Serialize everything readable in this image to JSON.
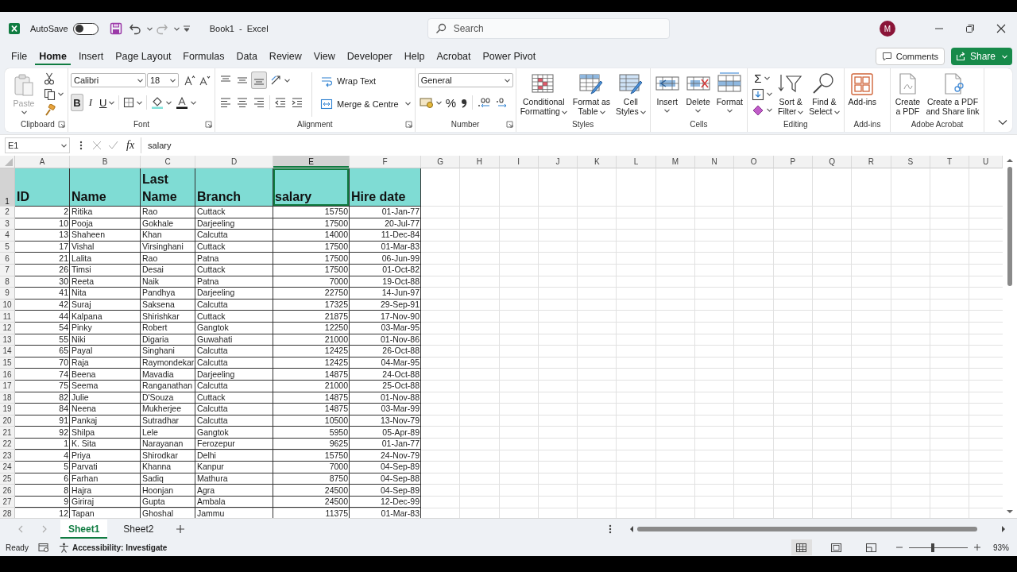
{
  "title_bar": {
    "autosave_label": "AutoSave",
    "autosave_on": false,
    "document_title": "Book1  -  Excel",
    "search_placeholder": "Search",
    "account_initial": "M"
  },
  "menu_tabs": [
    {
      "label": "File",
      "selected": false
    },
    {
      "label": "Home",
      "selected": true
    },
    {
      "label": "Insert",
      "selected": false
    },
    {
      "label": "Page Layout",
      "selected": false
    },
    {
      "label": "Formulas",
      "selected": false
    },
    {
      "label": "Data",
      "selected": false
    },
    {
      "label": "Review",
      "selected": false
    },
    {
      "label": "View",
      "selected": false
    },
    {
      "label": "Developer",
      "selected": false
    },
    {
      "label": "Help",
      "selected": false
    },
    {
      "label": "Acrobat",
      "selected": false
    },
    {
      "label": "Power Pivot",
      "selected": false
    }
  ],
  "comments_button": "Comments",
  "share_button": "Share",
  "ribbon": [
    {
      "kind": "clipboard",
      "label": "Clipboard",
      "launcher": true,
      "paste_label": "Paste",
      "paste_disabled": true
    },
    {
      "kind": "font",
      "label": "Font",
      "launcher": true,
      "font_name": "Calibri",
      "font_size": "18",
      "bold_label": "B",
      "italic_label": "I",
      "underline_label": "U",
      "bold": true
    },
    {
      "kind": "alignment",
      "label": "Alignment",
      "launcher": true,
      "vertical_align": [
        {
          "selected": false
        },
        {
          "selected": false
        },
        {
          "selected": true
        }
      ],
      "wrap_label": "Wrap Text",
      "merge_label": "Merge & Centre"
    },
    {
      "kind": "number",
      "label": "Number",
      "launcher": true,
      "format": "General",
      "percent_label": "%"
    },
    {
      "kind": "large",
      "label": "Styles",
      "launcher": false,
      "buttons": [
        {
          "lines": [
            "Conditional",
            "Formatting"
          ],
          "caret": true
        },
        {
          "lines": [
            "Format as",
            "Table"
          ],
          "caret": true
        },
        {
          "lines": [
            "Cell",
            "Styles"
          ],
          "caret": true
        }
      ]
    },
    {
      "kind": "large",
      "label": "Cells",
      "launcher": false,
      "buttons": [
        {
          "lines": [
            "Insert"
          ],
          "caret": true
        },
        {
          "lines": [
            "Delete"
          ],
          "caret": true
        },
        {
          "lines": [
            "Format"
          ],
          "caret": true
        }
      ]
    },
    {
      "kind": "editing",
      "label": "Editing",
      "launcher": false,
      "sum_label": "Σ",
      "buttons": [
        {
          "lines": [
            "Sort &",
            "Filter"
          ],
          "caret": true
        },
        {
          "lines": [
            "Find &",
            "Select"
          ],
          "caret": true
        }
      ]
    },
    {
      "kind": "large",
      "label": "Add-ins",
      "launcher": false,
      "buttons": [
        {
          "lines": [
            "Add-ins"
          ],
          "caret": false
        }
      ]
    },
    {
      "kind": "large",
      "label": "Adobe Acrobat",
      "launcher": false,
      "buttons": [
        {
          "lines": [
            "Create",
            "a PDF"
          ],
          "caret": false
        },
        {
          "lines": [
            "Create a PDF",
            "and Share link"
          ],
          "caret": false
        }
      ]
    }
  ],
  "formula_bar": {
    "name_box": "E1",
    "function_label": "fx",
    "formula": "salary"
  },
  "columns": [
    {
      "label": "A",
      "selected": false,
      "kind": "number"
    },
    {
      "label": "B",
      "selected": false,
      "kind": "text"
    },
    {
      "label": "C",
      "selected": false,
      "kind": "text"
    },
    {
      "label": "D",
      "selected": false,
      "kind": "text"
    },
    {
      "label": "E",
      "selected": true,
      "kind": "number"
    },
    {
      "label": "F",
      "selected": false,
      "kind": "number"
    },
    {
      "label": "G",
      "selected": false
    },
    {
      "label": "H",
      "selected": false
    },
    {
      "label": "I",
      "selected": false
    },
    {
      "label": "J",
      "selected": false
    },
    {
      "label": "K",
      "selected": false
    },
    {
      "label": "L",
      "selected": false
    },
    {
      "label": "M",
      "selected": false
    },
    {
      "label": "N",
      "selected": false
    },
    {
      "label": "O",
      "selected": false
    },
    {
      "label": "P",
      "selected": false
    },
    {
      "label": "Q",
      "selected": false
    },
    {
      "label": "R",
      "selected": false
    },
    {
      "label": "S",
      "selected": false
    },
    {
      "label": "T",
      "selected": false
    },
    {
      "label": "U",
      "selected": false
    }
  ],
  "rows": [
    {
      "number": "1",
      "selected": true,
      "kind": "header",
      "cells": [
        "ID",
        "Name",
        "Last Name",
        "Branch",
        "salary",
        "Hire date"
      ]
    },
    {
      "number": "2",
      "selected": false,
      "kind": "data",
      "cells": [
        "2",
        "Ritika",
        "Rao",
        "Cuttack",
        "15750",
        "01-Jan-77"
      ]
    },
    {
      "number": "3",
      "selected": false,
      "kind": "data",
      "cells": [
        "10",
        "Pooja",
        "Gokhale",
        "Darjeeling",
        "17500",
        "20-Jul-77"
      ]
    },
    {
      "number": "4",
      "selected": false,
      "kind": "data",
      "cells": [
        "13",
        "Shaheen",
        "Khan",
        "Calcutta",
        "14000",
        "11-Dec-84"
      ]
    },
    {
      "number": "5",
      "selected": false,
      "kind": "data",
      "cells": [
        "17",
        "Vishal",
        "Virsinghani",
        "Cuttack",
        "17500",
        "01-Mar-83"
      ]
    },
    {
      "number": "6",
      "selected": false,
      "kind": "data",
      "cells": [
        "21",
        "Lalita",
        "Rao",
        "Patna",
        "17500",
        "06-Jun-99"
      ]
    },
    {
      "number": "7",
      "selected": false,
      "kind": "data",
      "cells": [
        "26",
        "Timsi",
        "Desai",
        "Cuttack",
        "17500",
        "01-Oct-82"
      ]
    },
    {
      "number": "8",
      "selected": false,
      "kind": "data",
      "cells": [
        "30",
        "Reeta",
        "Naik",
        "Patna",
        "7000",
        "19-Oct-88"
      ]
    },
    {
      "number": "9",
      "selected": false,
      "kind": "data",
      "cells": [
        "41",
        "Nita",
        "Pandhya",
        "Darjeeling",
        "22750",
        "14-Jun-97"
      ]
    },
    {
      "number": "10",
      "selected": false,
      "kind": "data",
      "cells": [
        "42",
        "Suraj",
        "Saksena",
        "Calcutta",
        "17325",
        "29-Sep-91"
      ]
    },
    {
      "number": "11",
      "selected": false,
      "kind": "data",
      "cells": [
        "44",
        "Kalpana",
        "Shirishkar",
        "Cuttack",
        "21875",
        "17-Nov-90"
      ]
    },
    {
      "number": "12",
      "selected": false,
      "kind": "data",
      "cells": [
        "54",
        "Pinky",
        "Robert",
        "Gangtok",
        "12250",
        "03-Mar-95"
      ]
    },
    {
      "number": "13",
      "selected": false,
      "kind": "data",
      "cells": [
        "55",
        "Niki",
        "Digaria",
        "Guwahati",
        "21000",
        "01-Nov-86"
      ]
    },
    {
      "number": "14",
      "selected": false,
      "kind": "data",
      "cells": [
        "65",
        "Payal",
        "Singhani",
        "Calcutta",
        "12425",
        "26-Oct-88"
      ]
    },
    {
      "number": "15",
      "selected": false,
      "kind": "data",
      "cells": [
        "70",
        "Raja",
        "Raymondekar",
        "Calcutta",
        "12425",
        "04-Mar-95"
      ]
    },
    {
      "number": "16",
      "selected": false,
      "kind": "data",
      "cells": [
        "74",
        "Beena",
        "Mavadia",
        "Darjeeling",
        "14875",
        "24-Oct-88"
      ]
    },
    {
      "number": "17",
      "selected": false,
      "kind": "data",
      "cells": [
        "75",
        "Seema",
        "Ranganathan",
        "Calcutta",
        "21000",
        "25-Oct-88"
      ]
    },
    {
      "number": "18",
      "selected": false,
      "kind": "data",
      "cells": [
        "82",
        "Julie",
        "D'Souza",
        "Cuttack",
        "14875",
        "01-Nov-88"
      ]
    },
    {
      "number": "19",
      "selected": false,
      "kind": "data",
      "cells": [
        "84",
        "Neena",
        "Mukherjee",
        "Calcutta",
        "14875",
        "03-Mar-99"
      ]
    },
    {
      "number": "20",
      "selected": false,
      "kind": "data",
      "cells": [
        "91",
        "Pankaj",
        "Sutradhar",
        "Calcutta",
        "10500",
        "13-Nov-79"
      ]
    },
    {
      "number": "21",
      "selected": false,
      "kind": "data",
      "cells": [
        "92",
        "Shilpa",
        "Lele",
        "Gangtok",
        "5950",
        "05-Apr-89"
      ]
    },
    {
      "number": "22",
      "selected": false,
      "kind": "data",
      "cells": [
        "1",
        "K. Sita",
        "Narayanan",
        "Ferozepur",
        "9625",
        "01-Jan-77"
      ]
    },
    {
      "number": "23",
      "selected": false,
      "kind": "data",
      "cells": [
        "4",
        "Priya",
        "Shirodkar",
        "Delhi",
        "15750",
        "24-Nov-79"
      ]
    },
    {
      "number": "24",
      "selected": false,
      "kind": "data",
      "cells": [
        "5",
        "Parvati",
        "Khanna",
        "Kanpur",
        "7000",
        "04-Sep-89"
      ]
    },
    {
      "number": "25",
      "selected": false,
      "kind": "data",
      "cells": [
        "6",
        "Farhan",
        "Sadiq",
        "Mathura",
        "8750",
        "04-Sep-88"
      ]
    },
    {
      "number": "26",
      "selected": false,
      "kind": "data",
      "cells": [
        "8",
        "Hajra",
        "Hoonjan",
        "Agra",
        "24500",
        "04-Sep-89"
      ]
    },
    {
      "number": "27",
      "selected": false,
      "kind": "data",
      "cells": [
        "9",
        "Giriraj",
        "Gupta",
        "Ambala",
        "24500",
        "12-Dec-99"
      ]
    },
    {
      "number": "28",
      "selected": false,
      "kind": "data",
      "cells": [
        "12",
        "Tapan",
        "Ghoshal",
        "Jammu",
        "11375",
        "01-Mar-83"
      ]
    }
  ],
  "sheet_tabs": [
    {
      "label": "Sheet1",
      "selected": true
    },
    {
      "label": "Sheet2",
      "selected": false
    }
  ],
  "status_bar": {
    "mode": "Ready",
    "accessibility": "Accessibility: Investigate",
    "views": [
      {
        "selected": true
      },
      {
        "selected": false
      },
      {
        "selected": false
      }
    ],
    "zoom": {
      "level": 0.4,
      "reading": "93%"
    }
  }
}
